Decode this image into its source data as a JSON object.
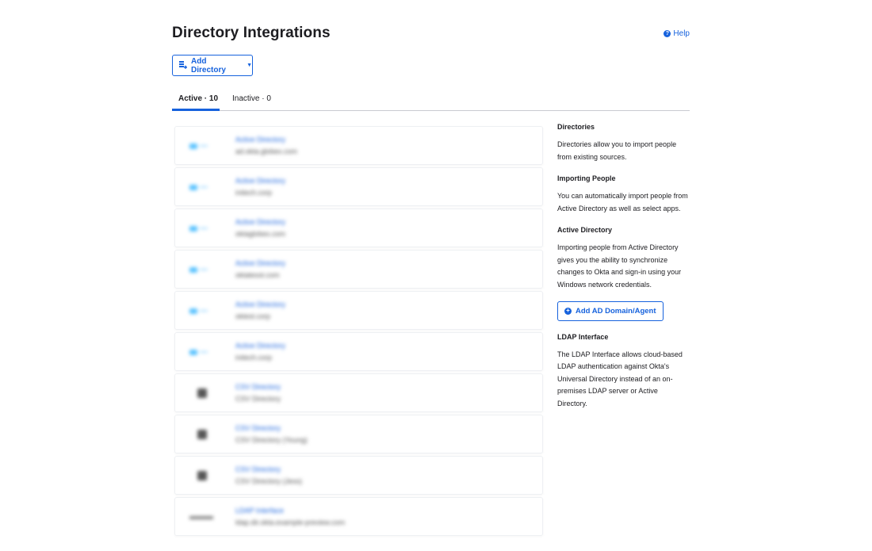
{
  "header": {
    "title": "Directory Integrations",
    "help_label": "Help"
  },
  "toolbar": {
    "add_directory_label": "Add Directory"
  },
  "tabs": [
    {
      "label": "Active · 10",
      "active": true
    },
    {
      "label": "Inactive · 0",
      "active": false
    }
  ],
  "integrations": [
    {
      "type": "ad",
      "title": "Active Directory",
      "subtitle": "ad.okta.globex.com"
    },
    {
      "type": "ad",
      "title": "Active Directory",
      "subtitle": "initech.corp"
    },
    {
      "type": "ad",
      "title": "Active Directory",
      "subtitle": "oktaglobex.com"
    },
    {
      "type": "ad",
      "title": "Active Directory",
      "subtitle": "oktatesst.com"
    },
    {
      "type": "ad",
      "title": "Active Directory",
      "subtitle": "oktest.corp"
    },
    {
      "type": "ad",
      "title": "Active Directory",
      "subtitle": "initech.corp"
    },
    {
      "type": "csv",
      "title": "CSV Directory",
      "subtitle": "CSV Directory"
    },
    {
      "type": "csv",
      "title": "CSV Directory",
      "subtitle": "CSV Directory (Young)"
    },
    {
      "type": "csv",
      "title": "CSV Directory",
      "subtitle": "CSV Directory (Jess)"
    },
    {
      "type": "ldap",
      "title": "LDAP Interface",
      "subtitle": "ldap.dir.okta.example-preview.com"
    }
  ],
  "sidebar": {
    "sections": [
      {
        "heading": "Directories",
        "text": "Directories allow you to import people from existing sources."
      },
      {
        "heading": "Importing People",
        "text": "You can automatically import people from Active Directory as well as select apps."
      },
      {
        "heading": "Active Directory",
        "text": "Importing people from Active Directory gives you the ability to synchronize changes to Okta and sign-in using your Windows network credentials."
      },
      {
        "heading": "LDAP Interface",
        "text": "The LDAP Interface allows cloud-based LDAP authentication against Okta's Universal Directory instead of an on-premises LDAP server or Active Directory."
      }
    ],
    "ad_agent_button_label": "Add AD Domain/Agent"
  },
  "colors": {
    "accent": "#1662dd",
    "text": "#1d1d21",
    "divider": "#c9cbd1"
  },
  "icons": {
    "help": "help-circle-icon",
    "add_directory": "add-directory-icon",
    "dropdown": "caret-down-icon",
    "add_agent": "plus-circle-icon"
  }
}
